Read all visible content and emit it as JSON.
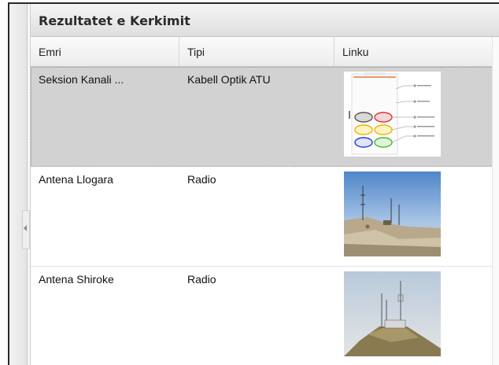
{
  "panel": {
    "title": "Rezultatet e Kerkimit"
  },
  "table": {
    "columns": [
      "Emri",
      "Tipi",
      "Linku"
    ],
    "rows": [
      {
        "name": "Seksion Kanali ...",
        "type": "Kabell Optik ATU",
        "thumbnail": "fiber-diagram-thumbnail",
        "selected": true
      },
      {
        "name": "Antena Llogara",
        "type": "Radio",
        "thumbnail": "antenna-photo-thumbnail",
        "selected": false
      },
      {
        "name": "Antena Shiroke",
        "type": "Radio",
        "thumbnail": "antenna-photo-thumbnail",
        "selected": false
      }
    ]
  },
  "colors": {
    "selected_row": "#d2d2d2",
    "header_text": "#2b2b2b",
    "frame_border": "#2a2a2a"
  },
  "icons": {
    "collapse": "chevron-left-icon"
  }
}
